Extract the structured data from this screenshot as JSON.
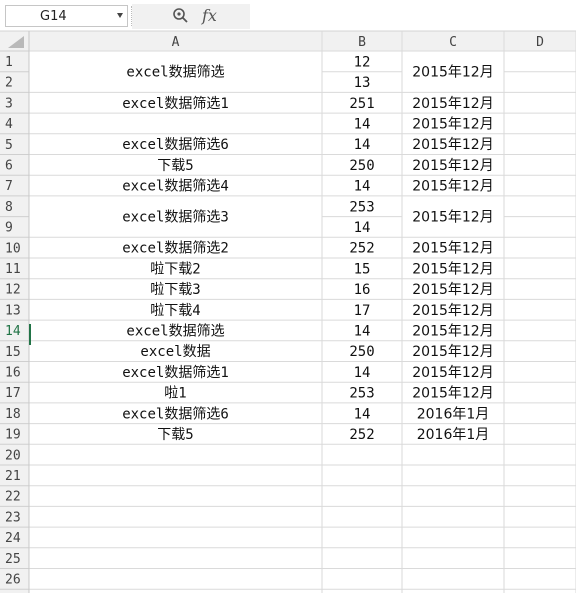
{
  "formula_bar": {
    "name_box": "G14",
    "fx_label": "fx",
    "formula": ""
  },
  "columns": [
    "A",
    "B",
    "C",
    "D"
  ],
  "row_numbers": [
    1,
    2,
    3,
    4,
    5,
    6,
    7,
    8,
    9,
    10,
    11,
    12,
    13,
    14,
    15,
    16,
    17,
    18,
    19,
    20,
    21,
    22,
    23,
    24,
    25,
    26
  ],
  "selected_row": 14,
  "colors": {
    "selected_accent": "#217346",
    "gridline": "#dadada",
    "header_bg": "#f1f1f1"
  },
  "cells": [
    {
      "r": 1,
      "span": 2,
      "a": "excel数据筛选",
      "c": "2015年12月"
    },
    {
      "r": 1,
      "b": "12"
    },
    {
      "r": 2,
      "b": "13"
    },
    {
      "r": 3,
      "a": "excel数据筛选1",
      "b": "251",
      "c": "2015年12月"
    },
    {
      "r": 4,
      "a": "",
      "b": "14",
      "c": "2015年12月"
    },
    {
      "r": 5,
      "a": "excel数据筛选6",
      "b": "14",
      "c": "2015年12月"
    },
    {
      "r": 6,
      "a": "下载5",
      "b": "250",
      "c": "2015年12月"
    },
    {
      "r": 7,
      "a": "excel数据筛选4",
      "b": "14",
      "c": "2015年12月"
    },
    {
      "r": 8,
      "span": 2,
      "a": "excel数据筛选3",
      "c": "2015年12月"
    },
    {
      "r": 8,
      "b": "253"
    },
    {
      "r": 9,
      "b": "14"
    },
    {
      "r": 10,
      "a": "excel数据筛选2",
      "b": "252",
      "c": "2015年12月"
    },
    {
      "r": 11,
      "a": "啦下载2",
      "b": "15",
      "c": "2015年12月"
    },
    {
      "r": 12,
      "a": "啦下载3",
      "b": "16",
      "c": "2015年12月"
    },
    {
      "r": 13,
      "a": "啦下载4",
      "b": "17",
      "c": "2015年12月"
    },
    {
      "r": 14,
      "a": "excel数据筛选",
      "b": "14",
      "c": "2015年12月"
    },
    {
      "r": 15,
      "a": "excel数据",
      "b": "250",
      "c": "2015年12月"
    },
    {
      "r": 16,
      "a": "excel数据筛选1",
      "b": "14",
      "c": "2015年12月"
    },
    {
      "r": 17,
      "a": "啦1",
      "b": "253",
      "c": "2015年12月"
    },
    {
      "r": 18,
      "a": "excel数据筛选6",
      "b": "14",
      "c": "2016年1月"
    },
    {
      "r": 19,
      "a": "下载5",
      "b": "252",
      "c": "2016年1月"
    }
  ]
}
